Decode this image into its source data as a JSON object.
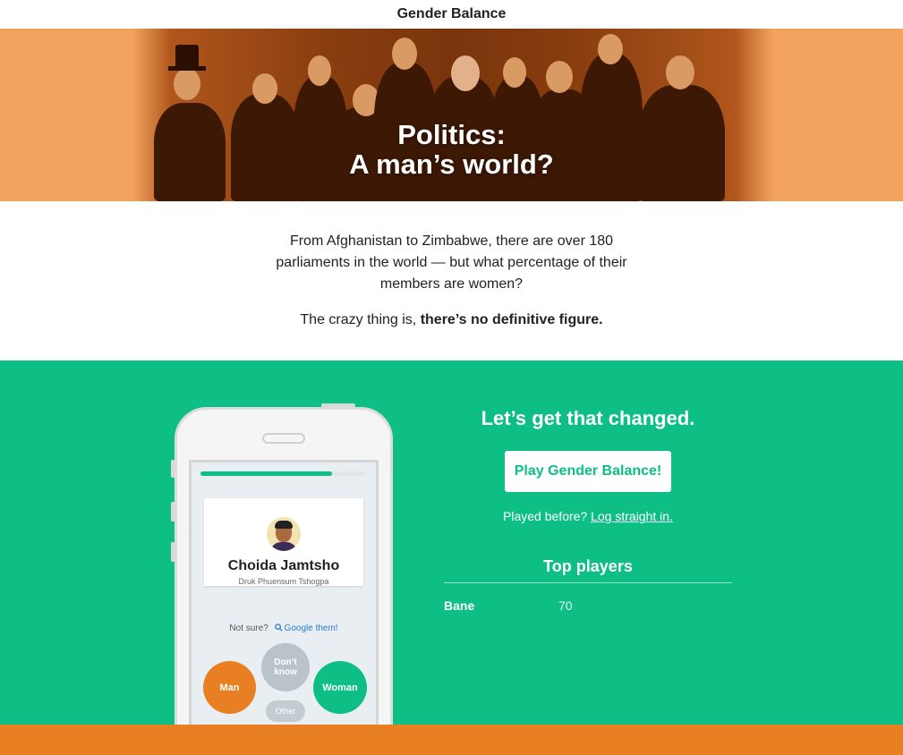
{
  "header": {
    "title": "Gender Balance"
  },
  "hero": {
    "title_line1": "Politics:",
    "title_line2": "A man’s world?"
  },
  "intro": {
    "paragraph1": "From Afghanistan to Zimbabwe, there are over 180 parliaments in the world — but what percentage of their members are women?",
    "paragraph2_prefix": "The crazy thing is, ",
    "paragraph2_bold": "there’s no definitive figure."
  },
  "phone": {
    "progress": 0.8,
    "politician_name": "Choida Jamtsho",
    "politician_party": "Druk Phuensum Tshogpa",
    "not_sure_text": "Not sure?",
    "google_link": "Google them!",
    "choices": {
      "man": "Man",
      "dont_know": "Don’t know",
      "woman": "Woman",
      "other": "Other"
    }
  },
  "cta": {
    "heading": "Let’s get that changed.",
    "play_button": "Play Gender Balance!",
    "played_before": "Played before?",
    "login_link": "Log straight in."
  },
  "leaderboard": {
    "title": "Top players",
    "players": [
      {
        "name": "Bane",
        "score": "70"
      }
    ]
  },
  "colors": {
    "green": "#0dbf84",
    "orange": "#e88023",
    "hero_orange": "#f3a35e",
    "link_blue": "#2a7bd1"
  }
}
